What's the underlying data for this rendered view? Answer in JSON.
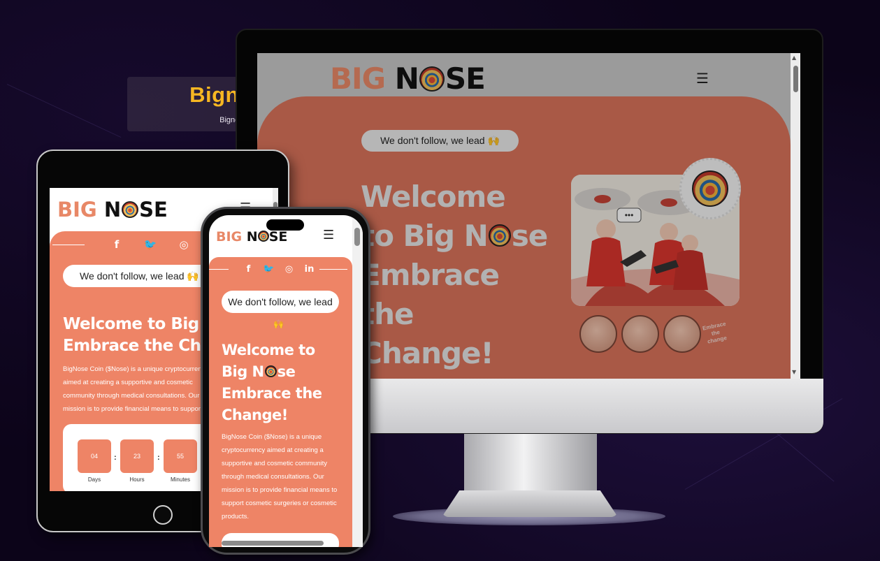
{
  "title": "Bignose",
  "subtitle": "Bignose",
  "logo": {
    "big": "BIG",
    "n": "N",
    "se": "SE"
  },
  "menu_icon": "hamburger-icon",
  "tagline": "We don't follow, we lead 🙌",
  "tagline_text": "We don't follow, we lead",
  "tagline_emoji": "🙌",
  "desktop": {
    "heading_lines": [
      "Welcome",
      "to Big N",
      "se",
      "Embrace",
      "the",
      "Change!"
    ],
    "image_caption": [
      "Embrace",
      "the",
      "change"
    ]
  },
  "tablet": {
    "heading": "Welcome to Big\nEmbrace the Ch",
    "paragraph": "BigNose Coin ($Nose) is a unique cryptocurrency aimed at creating a supportive and cosmetic community through medical consultations. Our mission is to provide financial means to support cosmetic surgeries or cosmetic products.",
    "countdown": [
      {
        "value": "04",
        "label": "Days"
      },
      {
        "value": "23",
        "label": "Hours"
      },
      {
        "value": "55",
        "label": "Minutes"
      }
    ]
  },
  "phone": {
    "heading_parts": [
      "Welcome to",
      "Big N",
      "se",
      "Embrace the",
      "Change!"
    ],
    "paragraph": "BigNose Coin ($Nose) is a unique cryptocurrency aimed at creating a supportive and cosmetic community through medical consultations. Our mission is to provide financial means to support cosmetic surgeries or cosmetic products."
  },
  "social_icons": [
    "facebook-icon",
    "twitter-icon",
    "instagram-icon",
    "linkedin-icon"
  ],
  "colors": {
    "accent": "#ee8466",
    "title": "#f7b722",
    "background": "#0c0419"
  }
}
